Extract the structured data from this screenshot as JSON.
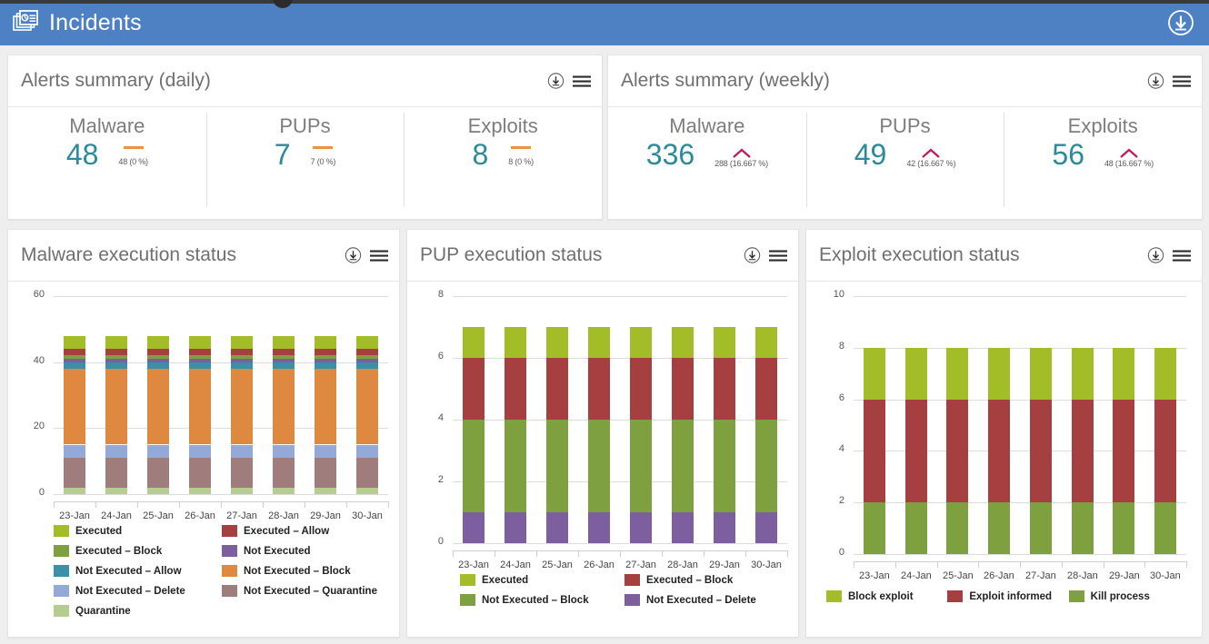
{
  "topbar": {
    "title": "Incidents",
    "icon": "incidents-report-icon",
    "download_icon": "download-circle-icon",
    "bg_color": "#4e81c4"
  },
  "panels": {
    "daily": {
      "title": "Alerts summary (daily)",
      "download_icon": "download-circle-icon",
      "menu_icon": "hamburger-menu-icon",
      "metrics": [
        {
          "name": "Malware",
          "value": "48",
          "trend": "flat",
          "sub": "48 (0 %)"
        },
        {
          "name": "PUPs",
          "value": "7",
          "trend": "flat",
          "sub": "7 (0 %)"
        },
        {
          "name": "Exploits",
          "value": "8",
          "trend": "flat",
          "sub": "8 (0 %)"
        }
      ]
    },
    "weekly": {
      "title": "Alerts summary (weekly)",
      "download_icon": "download-circle-icon",
      "menu_icon": "hamburger-menu-icon",
      "metrics": [
        {
          "name": "Malware",
          "value": "336",
          "trend": "up",
          "sub": "288 (16.667 %)"
        },
        {
          "name": "PUPs",
          "value": "49",
          "trend": "up",
          "sub": "42 (16.667 %)"
        },
        {
          "name": "Exploits",
          "value": "56",
          "trend": "up",
          "sub": "48 (16.667 %)"
        }
      ]
    }
  },
  "colors": {
    "value_teal": "#2b8a9b",
    "trend_flat": "#e8933f",
    "trend_up": "#c2185b",
    "header_blue": "#4e81c4",
    "card_bg": "#ffffff",
    "page_bg": "#eeeeee"
  },
  "chart_data": [
    {
      "id": "malware-execution-status",
      "type": "bar",
      "stacked": true,
      "title": "Malware execution status",
      "download_icon": "download-circle-icon",
      "menu_icon": "hamburger-menu-icon",
      "categories": [
        "23-Jan",
        "24-Jan",
        "25-Jan",
        "26-Jan",
        "27-Jan",
        "28-Jan",
        "29-Jan",
        "30-Jan"
      ],
      "xlabel": "",
      "ylabel": "",
      "ylim": [
        0,
        60
      ],
      "yticks": [
        0,
        20,
        40,
        60
      ],
      "grid": true,
      "legend_position": "bottom",
      "stack_total": 48,
      "series": [
        {
          "name": "Quarantine",
          "color": "#b5cd8e",
          "values": [
            2,
            2,
            2,
            2,
            2,
            2,
            2,
            2
          ]
        },
        {
          "name": "Not Executed – Quarantine",
          "color": "#a07d7d",
          "values": [
            9,
            9,
            9,
            9,
            9,
            9,
            9,
            9
          ]
        },
        {
          "name": "Not Executed – Delete",
          "color": "#93a9d8",
          "values": [
            4,
            4,
            4,
            4,
            4,
            4,
            4,
            4
          ]
        },
        {
          "name": "Not Executed – Block",
          "color": "#df8840",
          "values": [
            23,
            23,
            23,
            23,
            23,
            23,
            23,
            23
          ]
        },
        {
          "name": "Not Executed – Allow",
          "color": "#3b8fa8",
          "values": [
            2,
            2,
            2,
            2,
            2,
            2,
            2,
            2
          ]
        },
        {
          "name": "Not Executed",
          "color": "#7d5fa0",
          "values": [
            1,
            1,
            1,
            1,
            1,
            1,
            1,
            1
          ]
        },
        {
          "name": "Executed – Block",
          "color": "#7fa03f",
          "values": [
            1,
            1,
            1,
            1,
            1,
            1,
            1,
            1
          ]
        },
        {
          "name": "Executed – Allow",
          "color": "#a63f3f",
          "values": [
            2,
            2,
            2,
            2,
            2,
            2,
            2,
            2
          ]
        },
        {
          "name": "Executed",
          "color": "#a2bd28",
          "values": [
            4,
            4,
            4,
            4,
            4,
            4,
            4,
            4
          ]
        }
      ],
      "legend_order": [
        "Executed",
        "Executed – Allow",
        "Executed – Block",
        "Not Executed",
        "Not Executed – Allow",
        "Not Executed – Block",
        "Not Executed – Delete",
        "Not Executed – Quarantine",
        "Quarantine"
      ]
    },
    {
      "id": "pup-execution-status",
      "type": "bar",
      "stacked": true,
      "title": "PUP execution status",
      "download_icon": "download-circle-icon",
      "menu_icon": "hamburger-menu-icon",
      "categories": [
        "23-Jan",
        "24-Jan",
        "25-Jan",
        "26-Jan",
        "27-Jan",
        "28-Jan",
        "29-Jan",
        "30-Jan"
      ],
      "xlabel": "",
      "ylabel": "",
      "ylim": [
        0,
        8
      ],
      "yticks": [
        0,
        2,
        4,
        6,
        8
      ],
      "grid": true,
      "legend_position": "bottom",
      "stack_total": 7,
      "series": [
        {
          "name": "Not Executed – Delete",
          "color": "#7d5fa0",
          "values": [
            1,
            1,
            1,
            1,
            1,
            1,
            1,
            1
          ]
        },
        {
          "name": "Not Executed – Block",
          "color": "#7fa03f",
          "values": [
            3,
            3,
            3,
            3,
            3,
            3,
            3,
            3
          ]
        },
        {
          "name": "Executed – Block",
          "color": "#a63f3f",
          "values": [
            2,
            2,
            2,
            2,
            2,
            2,
            2,
            2
          ]
        },
        {
          "name": "Executed",
          "color": "#a2bd28",
          "values": [
            1,
            1,
            1,
            1,
            1,
            1,
            1,
            1
          ]
        }
      ],
      "legend_order": [
        "Executed",
        "Executed – Block",
        "Not Executed – Block",
        "Not Executed – Delete"
      ]
    },
    {
      "id": "exploit-execution-status",
      "type": "bar",
      "stacked": true,
      "title": "Exploit execution status",
      "download_icon": "download-circle-icon",
      "menu_icon": "hamburger-menu-icon",
      "categories": [
        "23-Jan",
        "24-Jan",
        "25-Jan",
        "26-Jan",
        "27-Jan",
        "28-Jan",
        "29-Jan",
        "30-Jan"
      ],
      "xlabel": "",
      "ylabel": "",
      "ylim": [
        0,
        10
      ],
      "yticks": [
        0,
        2,
        4,
        6,
        8,
        10
      ],
      "grid": true,
      "legend_position": "bottom",
      "stack_total": 8,
      "series": [
        {
          "name": "Kill process",
          "color": "#7fa03f",
          "values": [
            2,
            2,
            2,
            2,
            2,
            2,
            2,
            2
          ]
        },
        {
          "name": "Exploit informed",
          "color": "#a63f3f",
          "values": [
            4,
            4,
            4,
            4,
            4,
            4,
            4,
            4
          ]
        },
        {
          "name": "Block exploit",
          "color": "#a2bd28",
          "values": [
            2,
            2,
            2,
            2,
            2,
            2,
            2,
            2
          ]
        }
      ],
      "legend_order": [
        "Block exploit",
        "Exploit informed",
        "Kill process"
      ]
    }
  ]
}
